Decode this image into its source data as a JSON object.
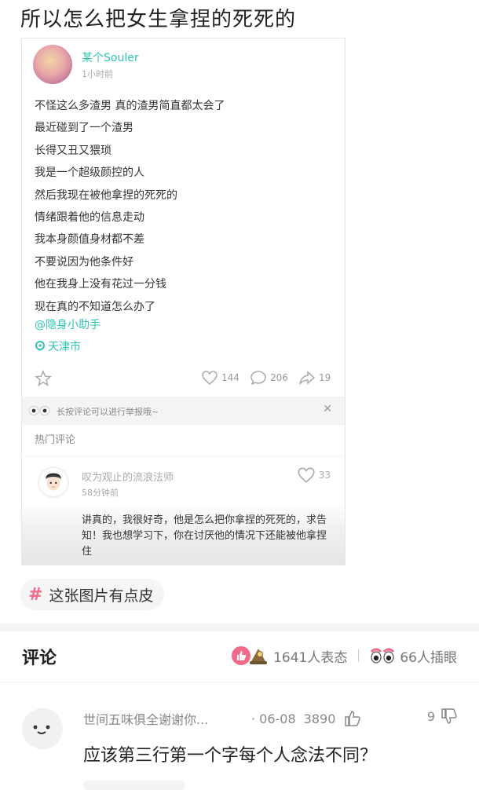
{
  "page_title": "所以怎么把女生拿捏的死死的",
  "embedded_post": {
    "username": "某个Souler",
    "time": "1小时前",
    "lines": [
      "不怪这么多渣男 真的渣男简直都太会了",
      "最近碰到了一个渣男",
      "长得又丑又猥琐",
      "我是一个超级颜控的人",
      "然后我现在被他拿捏的死死的",
      "情绪跟着他的信息走动",
      "我本身颜值身材都不差",
      "不要说因为他条件好",
      "他在我身上没有花过一分钱",
      "现在真的不知道怎么办了"
    ],
    "mention": "@隐身小助手",
    "location": "天津市",
    "likes": "144",
    "comments": "206",
    "shares": "19",
    "notice": "长按评论可以进行举报哦~",
    "hot_comments_label": "热门评论",
    "comment": {
      "name": "叹为观止的流浪法师",
      "time": "58分钟前",
      "likes": "33",
      "text": "讲真的，我很好奇，他是怎么把你拿捏的死死的，求告知！我也想学习下，你在讨厌他的情况下还能被他拿捏住"
    }
  },
  "tag": {
    "label": "这张图片有点皮"
  },
  "comments_section": {
    "heading": "评论",
    "reactions_count": "1641人表态",
    "insert_eye_count": "66人插眼",
    "items": [
      {
        "name": "世间五味俱全谢谢你...",
        "date": "· 06-08",
        "likes": "3890",
        "dislikes": "9",
        "text": "应该第三行第一个字每个人念法不同？"
      }
    ]
  },
  "colors": {
    "accent": "#2ec4b6",
    "brand_pink": "#f06a8a"
  }
}
